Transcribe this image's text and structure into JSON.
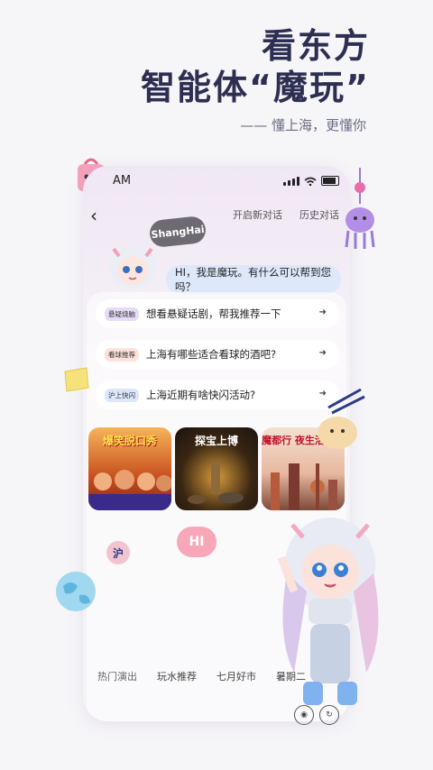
{
  "hero": {
    "line1": "看东方",
    "line2": "智能体“魔玩”",
    "subtitle": "—— 懂上海，更懂你"
  },
  "status": {
    "time": "AM"
  },
  "header": {
    "new_chat": "开启新对话",
    "history": "历史对话"
  },
  "mascot": {
    "bubble": "ShangHai",
    "greeting": "HI，我是魔玩。有什么可以帮到您吗？"
  },
  "questions": [
    {
      "tag": "悬疑烧脑",
      "text": "想看悬疑话剧，帮我推荐一下",
      "tag_color": "#e7dcf7"
    },
    {
      "tag": "看球推荐",
      "text": "上海有哪些适合看球的酒吧?",
      "tag_color": "#fde2dc"
    },
    {
      "tag": "沪上快闪",
      "text": "上海近期有啥快闪活动?",
      "tag_color": "#dde7fb"
    }
  ],
  "posters": [
    {
      "title": "爆笑脱口秀"
    },
    {
      "title": "探宝上博"
    },
    {
      "title": "魔都行 夜生活指南"
    }
  ],
  "bottom_tabs": [
    "热门演出",
    "玩水推荐",
    "七月好市",
    "暑期二"
  ],
  "decor": {
    "hi_bubble": "HI",
    "hu_badge": "沪"
  }
}
